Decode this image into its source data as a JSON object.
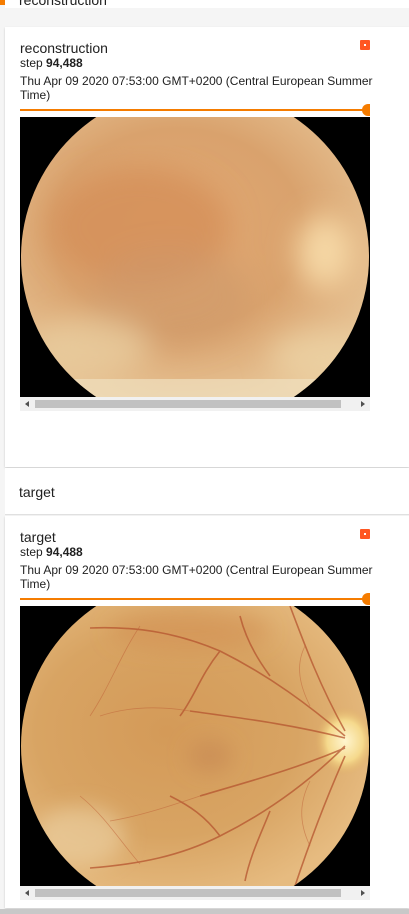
{
  "sections": [
    {
      "header": "reconstruction",
      "card": {
        "tag": "reconstruction",
        "step_label": "step",
        "step_value": "94,488",
        "timestamp": "Thu Apr 09 2020 07:53:00 GMT+0200 (Central European Summer Time)",
        "slider_value": 1.0,
        "image_kind": "blurred-retina"
      }
    },
    {
      "header": "target",
      "card": {
        "tag": "target",
        "step_label": "step",
        "step_value": "94,488",
        "timestamp": "Thu Apr 09 2020 07:53:00 GMT+0200 (Central European Summer Time)",
        "slider_value": 1.0,
        "image_kind": "retina-fundus"
      }
    }
  ],
  "colors": {
    "accent": "#f57c00",
    "download_icon": "#ff5722",
    "scrollbar_thumb": "#c1c1c1"
  },
  "icons": {
    "download": "download-icon",
    "scroll_left": "chevron-left-icon",
    "scroll_right": "chevron-right-icon"
  }
}
